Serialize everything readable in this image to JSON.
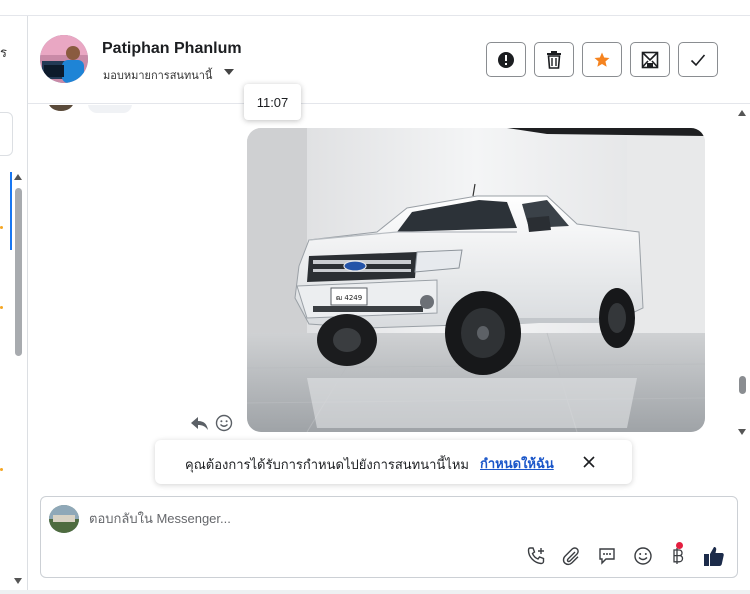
{
  "sidebar": {
    "clipped_text": "ร"
  },
  "header": {
    "contact_name": "Patiphan Phanlum",
    "assign_label": "มอบหมายการสนทนานี้",
    "actions": [
      {
        "icon": "alert-circle-icon"
      },
      {
        "icon": "trash-icon"
      },
      {
        "icon": "star-icon",
        "accent": "#f5831f"
      },
      {
        "icon": "archive-envelope-icon"
      },
      {
        "icon": "check-icon"
      }
    ]
  },
  "thread": {
    "timestamp_tooltip": "11:07",
    "message_image": {
      "subject": "white pickup truck photo",
      "plate_text": "ฒ 4249"
    }
  },
  "banner": {
    "text": "คุณต้องการได้รับการกำหนดไปยังการสนทนานี้ไหม",
    "link": "กำหนดให้ฉัน",
    "link_color": "#1a56c9"
  },
  "composer": {
    "placeholder": "ตอบกลับใน Messenger...",
    "tools": [
      "add-call-icon",
      "attachment-icon",
      "saved-replies-icon",
      "emoji-icon",
      "baht-payment-icon",
      "thumbs-up-icon"
    ],
    "thumbs_color": "#1c2b4a",
    "notification_dot_color": "#e41e3f"
  }
}
